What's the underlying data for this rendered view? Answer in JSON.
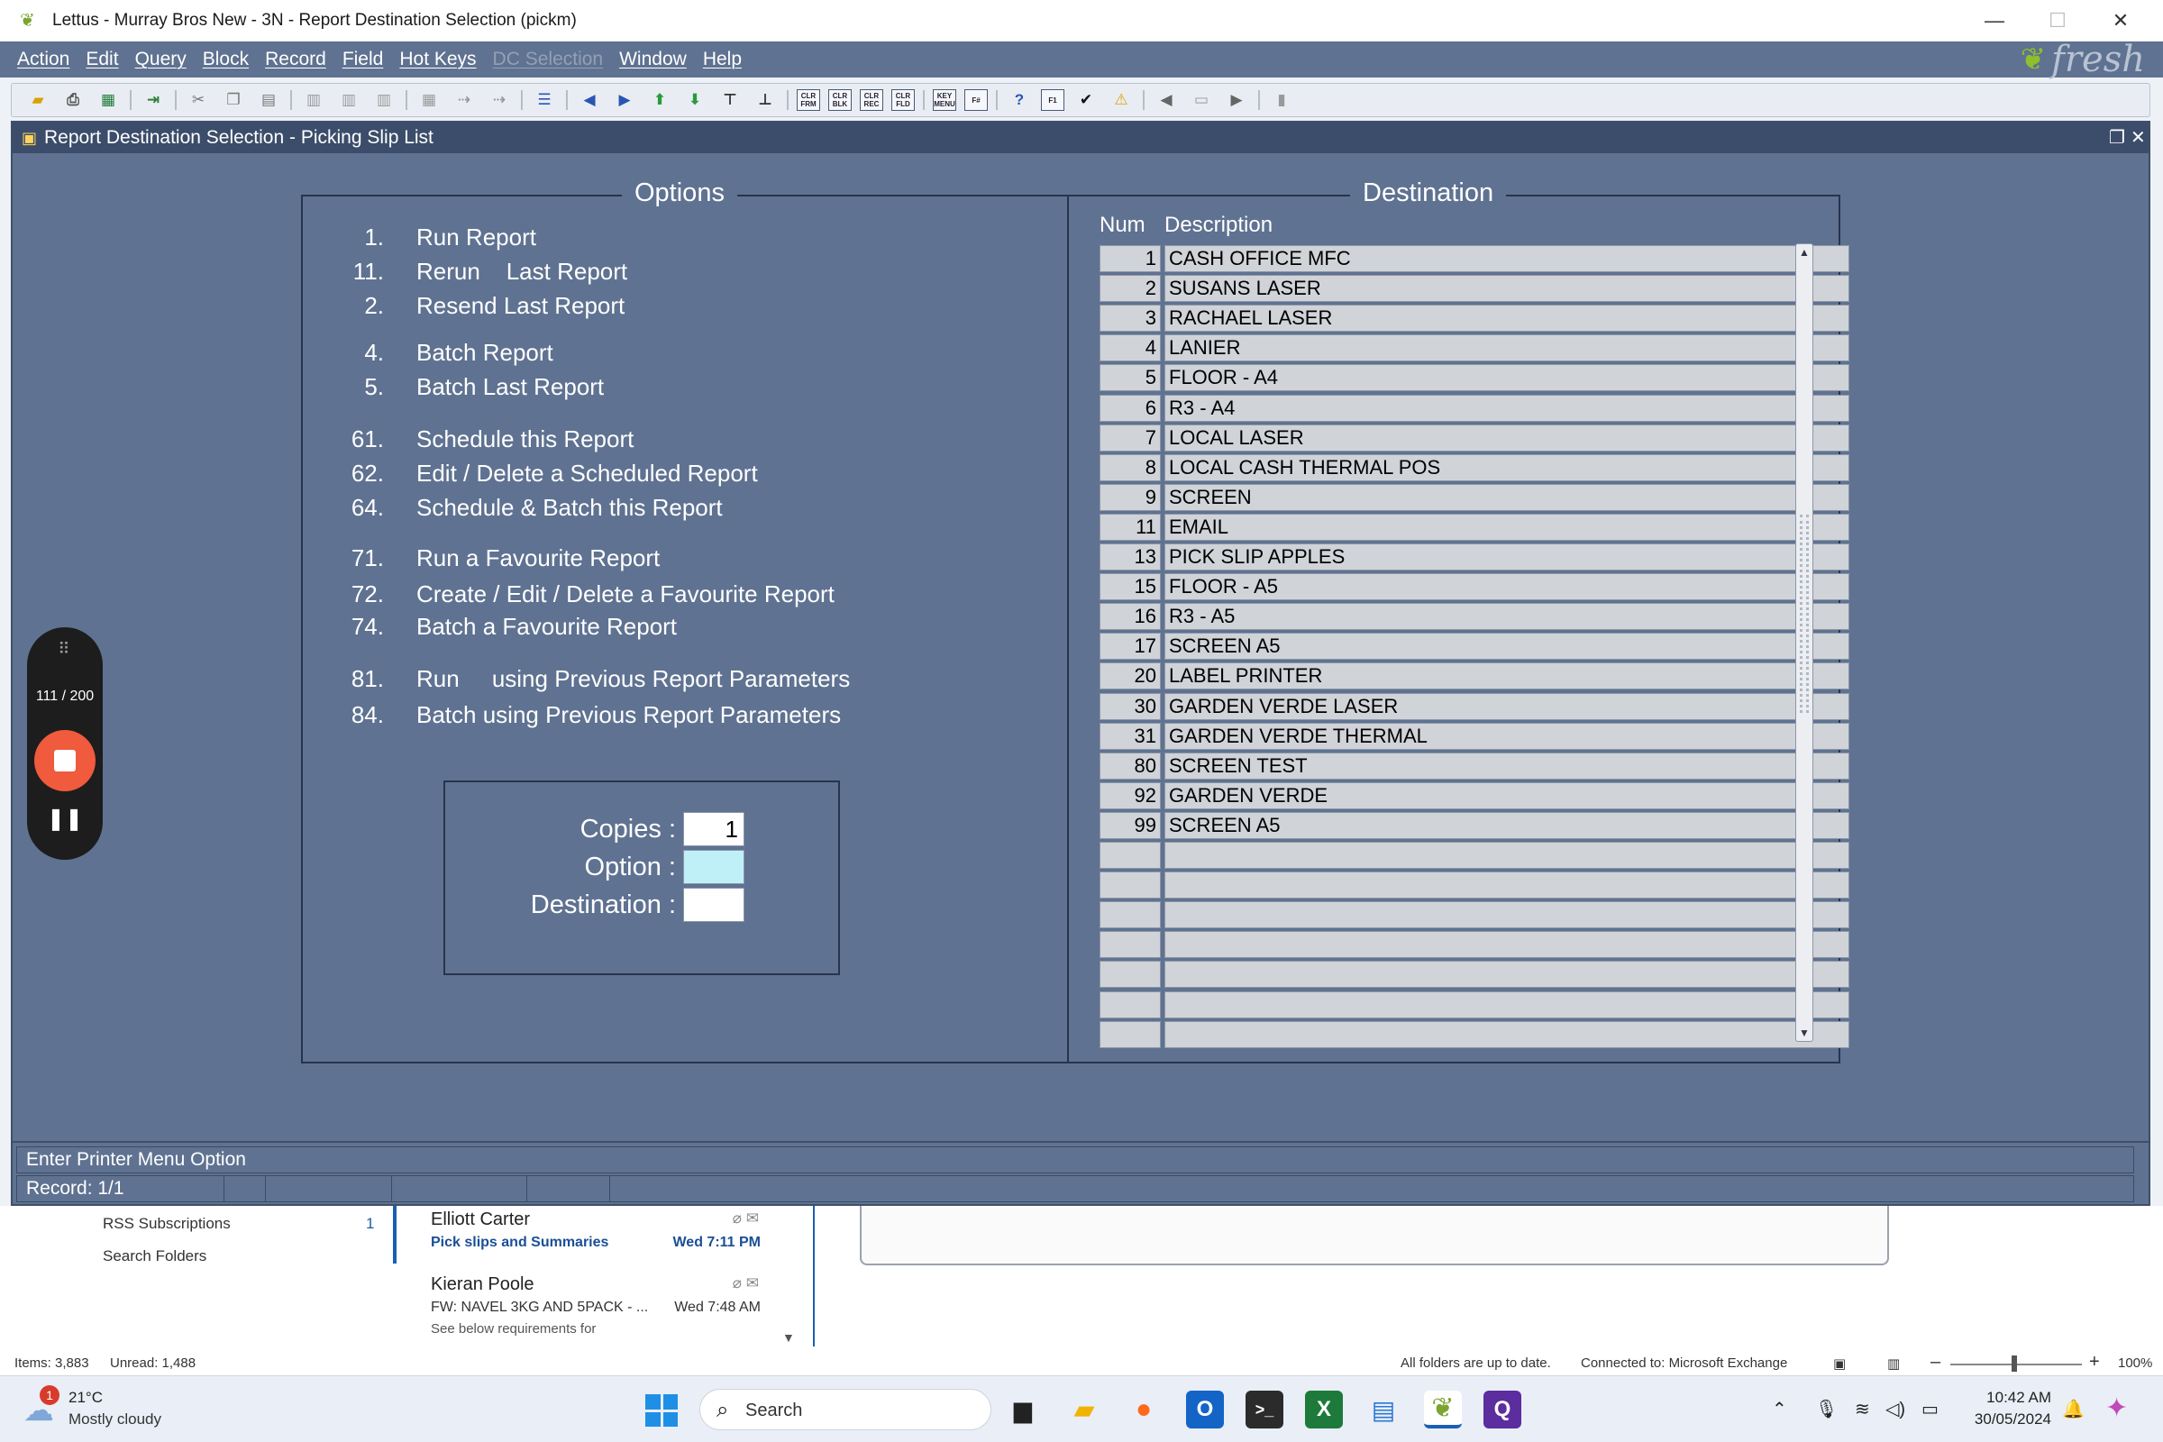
{
  "window": {
    "title": "Lettus - Murray Bros New - 3N - Report Destination Selection (pickm)",
    "controls": {
      "minimize": "—",
      "maximize": "☐",
      "close": "✕"
    }
  },
  "menubar": {
    "items": [
      "Action",
      "Edit",
      "Query",
      "Block",
      "Record",
      "Field",
      "Hot Keys",
      "DC Selection",
      "Window",
      "Help"
    ],
    "disabled_item": "DC Selection",
    "logo_text": "fresh"
  },
  "toolbar": {
    "box_labels": [
      "CLR FRM",
      "CLR BLK",
      "CLR REC",
      "CLR FLD",
      "KEY MENU",
      "F#",
      "F1"
    ]
  },
  "form": {
    "title": "Report Destination Selection - Picking Slip List",
    "options_legend": "Options",
    "destination_legend": "Destination",
    "options": [
      {
        "num": "1.",
        "label": "Run Report"
      },
      {
        "num": "11.",
        "label": "Rerun    Last Report"
      },
      {
        "num": "2.",
        "label": "Resend Last Report"
      },
      {
        "num": "4.",
        "label": "Batch Report"
      },
      {
        "num": "5.",
        "label": "Batch Last Report"
      },
      {
        "num": "61.",
        "label": "Schedule this Report"
      },
      {
        "num": "62.",
        "label": "Edit / Delete a Scheduled Report"
      },
      {
        "num": "64.",
        "label": "Schedule & Batch this Report"
      },
      {
        "num": "71.",
        "label": "Run a Favourite Report"
      },
      {
        "num": "72.",
        "label": "Create / Edit / Delete a Favourite Report"
      },
      {
        "num": "74.",
        "label": "Batch a Favourite Report"
      },
      {
        "num": "81.",
        "label": "Run     using Previous Report Parameters"
      },
      {
        "num": "84.",
        "label": "Batch using Previous Report Parameters"
      }
    ],
    "inputs": {
      "copies_label": "Copies :",
      "copies_value": "1",
      "option_label": "Option :",
      "option_value": "",
      "destination_label": "Destination :",
      "destination_value": ""
    },
    "dest_headers": {
      "num": "Num",
      "description": "Description"
    },
    "destinations": [
      {
        "num": "1",
        "desc": "CASH OFFICE MFC"
      },
      {
        "num": "2",
        "desc": "SUSANS LASER"
      },
      {
        "num": "3",
        "desc": "RACHAEL LASER"
      },
      {
        "num": "4",
        "desc": "LANIER"
      },
      {
        "num": "5",
        "desc": "FLOOR - A4"
      },
      {
        "num": "6",
        "desc": "R3 - A4"
      },
      {
        "num": "7",
        "desc": "LOCAL LASER"
      },
      {
        "num": "8",
        "desc": "LOCAL CASH THERMAL POS"
      },
      {
        "num": "9",
        "desc": "SCREEN"
      },
      {
        "num": "11",
        "desc": "EMAIL"
      },
      {
        "num": "13",
        "desc": "PICK SLIP APPLES"
      },
      {
        "num": "15",
        "desc": "FLOOR - A5"
      },
      {
        "num": "16",
        "desc": "R3 - A5"
      },
      {
        "num": "17",
        "desc": "SCREEN A5"
      },
      {
        "num": "20",
        "desc": "LABEL PRINTER"
      },
      {
        "num": "30",
        "desc": "GARDEN VERDE LASER"
      },
      {
        "num": "31",
        "desc": "GARDEN VERDE THERMAL"
      },
      {
        "num": "80",
        "desc": "SCREEN TEST"
      },
      {
        "num": "92",
        "desc": "GARDEN VERDE"
      },
      {
        "num": "99",
        "desc": "SCREEN A5"
      },
      {
        "num": "",
        "desc": ""
      },
      {
        "num": "",
        "desc": ""
      },
      {
        "num": "",
        "desc": ""
      },
      {
        "num": "",
        "desc": ""
      },
      {
        "num": "",
        "desc": ""
      },
      {
        "num": "",
        "desc": ""
      },
      {
        "num": "",
        "desc": ""
      }
    ]
  },
  "status": {
    "message": "Enter Printer Menu Option",
    "record": "Record: 1/1"
  },
  "recorder": {
    "count": "111 / 200"
  },
  "outlook": {
    "folders": [
      {
        "name": "RSS Subscriptions",
        "count": "1"
      },
      {
        "name": "Search Folders",
        "count": ""
      }
    ],
    "mails": [
      {
        "sender": "Elliott Carter",
        "subject": "Pick slips and Summaries",
        "time": "Wed 7:11 PM",
        "preview": ""
      },
      {
        "sender": "Kieran Poole",
        "subject": "FW: NAVEL 3KG AND 5PACK - ...",
        "time": "Wed 7:48 AM",
        "preview": "See below requirements for"
      }
    ],
    "status_items": "Items: 3,883",
    "status_unread": "Unread: 1,488",
    "status_sync": "All folders are up to date.",
    "status_conn": "Connected to: Microsoft Exchange",
    "zoom": "100%"
  },
  "taskbar": {
    "weather_temp": "21°C",
    "weather_cond": "Mostly cloudy",
    "weather_badge": "1",
    "search_placeholder": "Search",
    "time": "10:42 AM",
    "date": "30/05/2024"
  },
  "colors": {
    "form_bg": "#5f7291",
    "cell_bg": "#d0d3d8",
    "active_field": "#bff0f8",
    "record_button": "#f05a3d"
  }
}
